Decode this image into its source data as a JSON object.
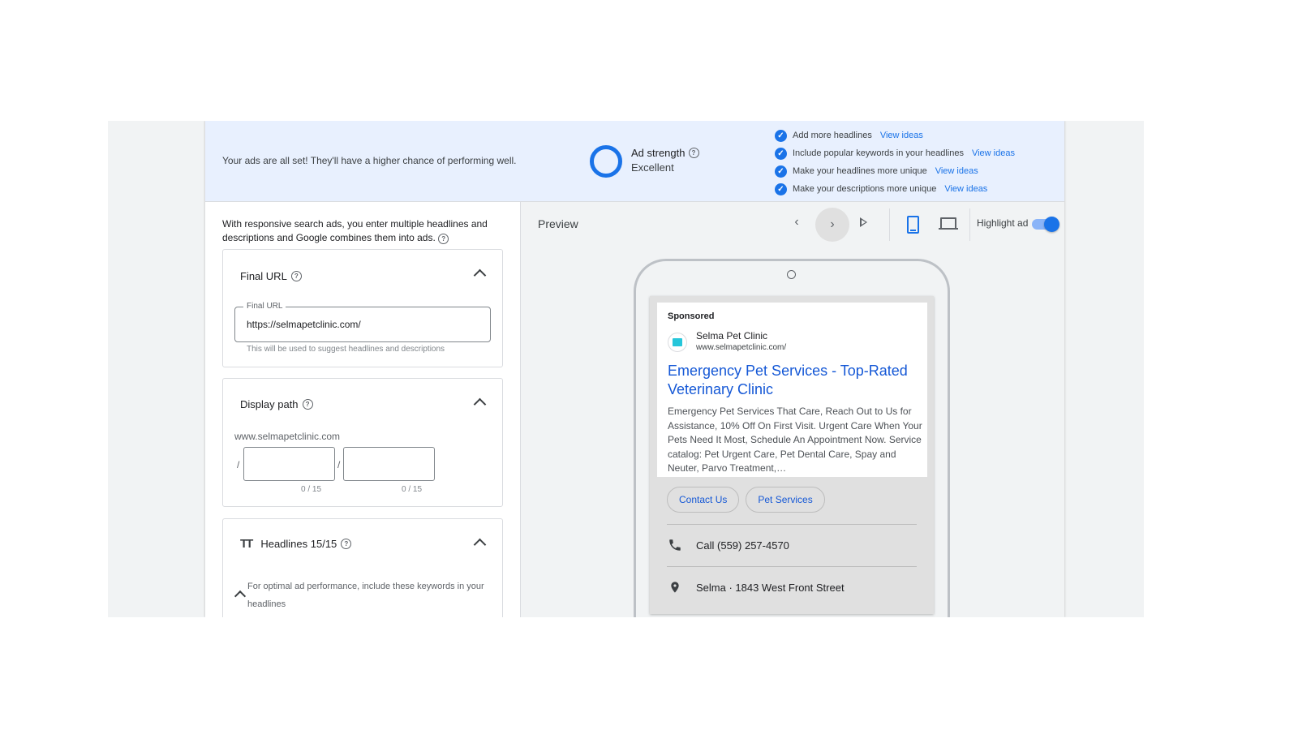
{
  "banner": {
    "message": "Your ads are all set! They'll have a higher chance of performing well.",
    "ad_strength_label": "Ad strength",
    "ad_strength_value": "Excellent",
    "tips": [
      {
        "text": "Add more headlines",
        "link": "View ideas"
      },
      {
        "text": "Include popular keywords in your headlines",
        "link": "View ideas"
      },
      {
        "text": "Make your headlines more unique",
        "link": "View ideas"
      },
      {
        "text": "Make your descriptions more unique",
        "link": "View ideas"
      }
    ]
  },
  "editor": {
    "intro": "With responsive search ads, you enter multiple headlines and descriptions and Google combines them into ads.",
    "final_url": {
      "title": "Final URL",
      "field_label": "Final URL",
      "value": "https://selmapetclinic.com/",
      "hint": "This will be used to suggest headlines and descriptions"
    },
    "display_path": {
      "title": "Display path",
      "domain": "www.selmapetclinic.com",
      "slash": "/",
      "path1": "",
      "path2": "",
      "count1": "0 / 15",
      "count2": "0 / 15"
    },
    "headlines": {
      "icon_glyph": "TT",
      "title": "Headlines 15/15",
      "keywords_hint": "For optimal ad performance, include these keywords in your headlines"
    }
  },
  "preview": {
    "title": "Preview",
    "highlight_label": "Highlight ad",
    "highlight_on": true,
    "device": "mobile",
    "ad": {
      "sponsored": "Sponsored",
      "business_name": "Selma Pet Clinic",
      "display_url": "www.selmapetclinic.com/",
      "headline": "Emergency Pet Services - Top-Rated Veterinary Clinic",
      "description": "Emergency Pet Services That Care, Reach Out to Us for Assistance, 10% Off On First Visit. Urgent Care When Your Pets Need It Most, Schedule An Appointment Now. Service catalog: Pet Urgent Care, Pet Dental Care, Spay and Neuter, Parvo Treatment,…",
      "sitelinks": [
        "Contact Us",
        "Pet Services"
      ],
      "call": "Call (559) 257-4570",
      "location": "Selma · 1843 West Front Street"
    }
  },
  "colors": {
    "accent": "#1a73e8",
    "banner_bg": "#e8f0fe",
    "headline_link": "#1558d6",
    "logo": "#26c6da"
  }
}
